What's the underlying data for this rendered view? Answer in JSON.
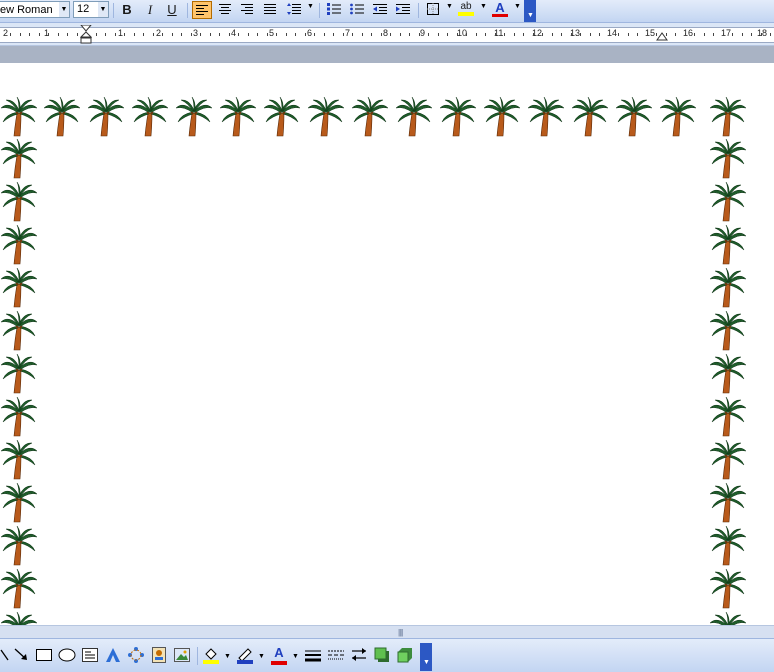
{
  "formatting_toolbar": {
    "font_name": "ew Roman",
    "font_size": "12",
    "bold": "B",
    "italic": "I",
    "underline": "U",
    "font_color_glyph": "A",
    "highlight_glyph": "ab",
    "alignment_selected": "align-left"
  },
  "ruler": {
    "labels": [
      "2",
      "1",
      "1",
      "2",
      "3",
      "4",
      "5",
      "6",
      "7",
      "8",
      "9",
      "10",
      "11",
      "12",
      "13",
      "14",
      "15",
      "16",
      "17",
      "18"
    ]
  },
  "document": {
    "page_border_art": "palm-tree",
    "border_color_trunk": "#b85a1b",
    "border_color_leaves": "#1e5c2a"
  },
  "drawing_toolbar": {
    "font_color_glyph": "A",
    "fill_color": "#ffff00",
    "line_color": "#1f3fbf",
    "font_color": "#e00000"
  }
}
